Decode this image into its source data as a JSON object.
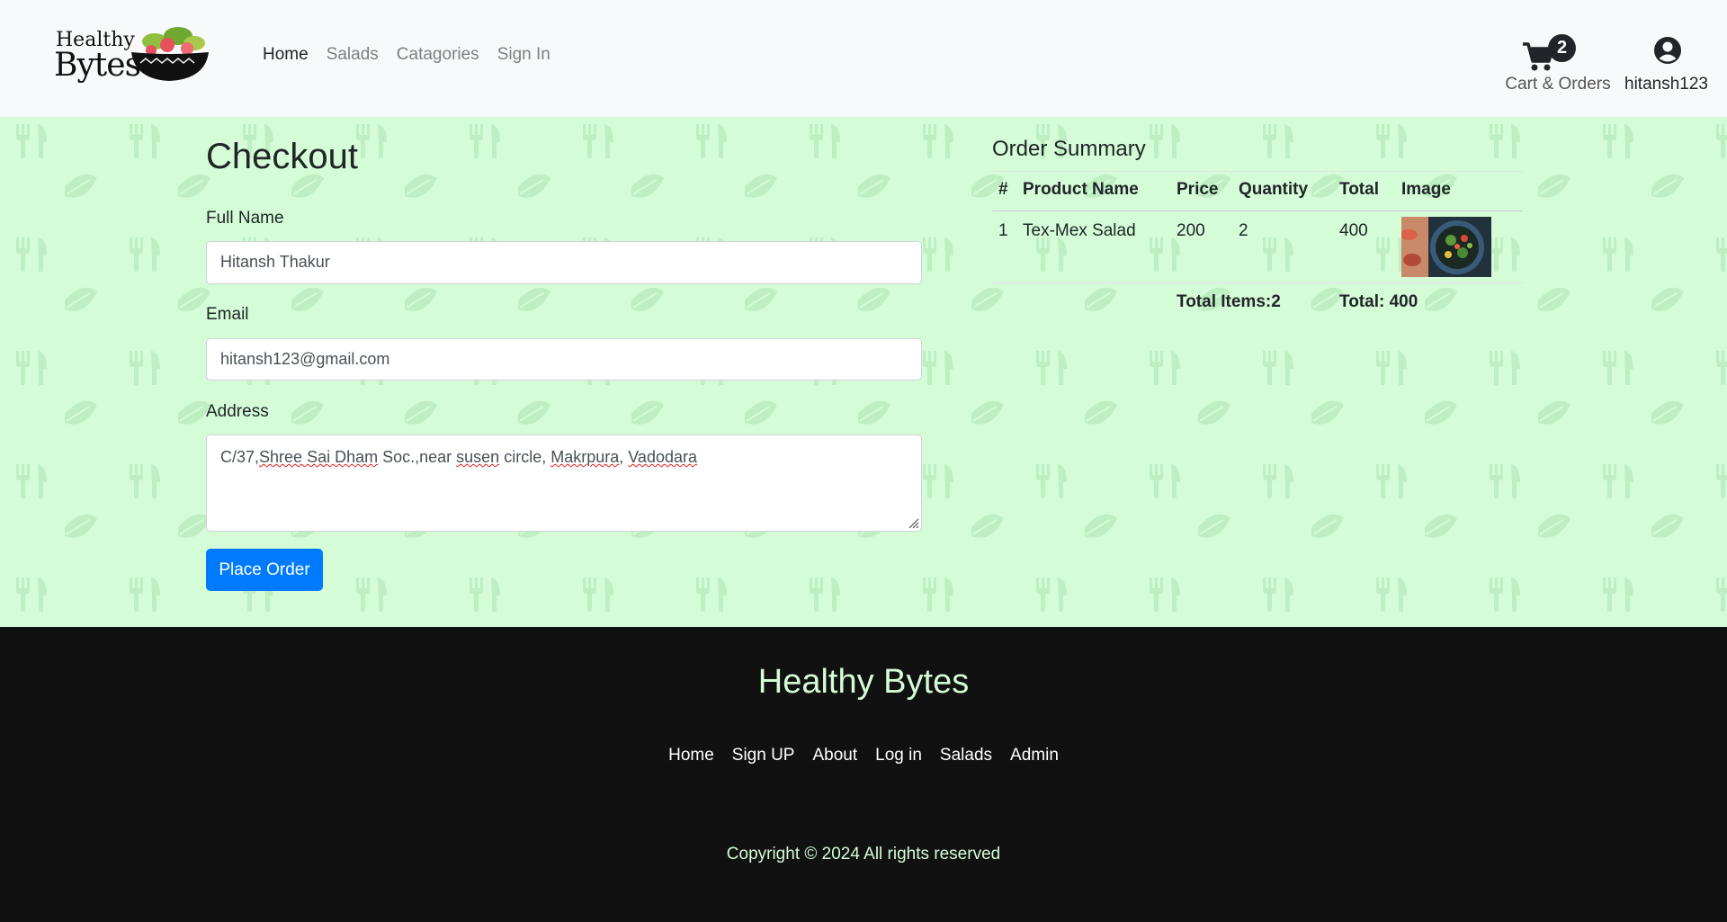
{
  "brand": {
    "logo_line1": "Healthy",
    "logo_line2": "Bytes"
  },
  "nav": {
    "items": [
      {
        "label": "Home",
        "active": true
      },
      {
        "label": "Salads",
        "active": false
      },
      {
        "label": "Catagories",
        "active": false
      },
      {
        "label": "Sign In",
        "active": false
      }
    ]
  },
  "cart": {
    "count": "2",
    "label": "Cart & Orders",
    "icon": "cart-icon"
  },
  "user": {
    "name": "hitansh123",
    "icon": "user-circle-icon"
  },
  "checkout": {
    "title": "Checkout",
    "full_name_label": "Full Name",
    "full_name_value": "Hitansh Thakur",
    "email_label": "Email",
    "email_value": "hitansh123@gmail.com",
    "address_label": "Address",
    "address_parts": [
      "C/37,",
      "Shree Sai Dham",
      " Soc.,near ",
      "susen",
      " circle, ",
      "Makrpura",
      ", ",
      "Vadodara"
    ],
    "place_order_label": "Place Order"
  },
  "summary": {
    "title": "Order Summary",
    "headers": [
      "#",
      "Product Name",
      "Price",
      "Quantity",
      "Total",
      "Image"
    ],
    "rows": [
      {
        "num": "1",
        "name": "Tex-Mex Salad",
        "price": "200",
        "quantity": "2",
        "total": "400",
        "image": "salad-photo"
      }
    ],
    "total_items": "Total Items:2",
    "total": "Total: 400"
  },
  "footer": {
    "title": "Healthy Bytes",
    "links": [
      "Home",
      "Sign UP",
      "About",
      "Log in",
      "Salads",
      "Admin"
    ],
    "copyright": "Copyright © 2024 All rights reserved"
  },
  "colors": {
    "navbar_bg": "#f8f9fa",
    "main_bg": "#d4fcd6",
    "primary_button": "#007bff",
    "footer_bg": "#111111",
    "footer_accent": "#d4fcd6"
  }
}
